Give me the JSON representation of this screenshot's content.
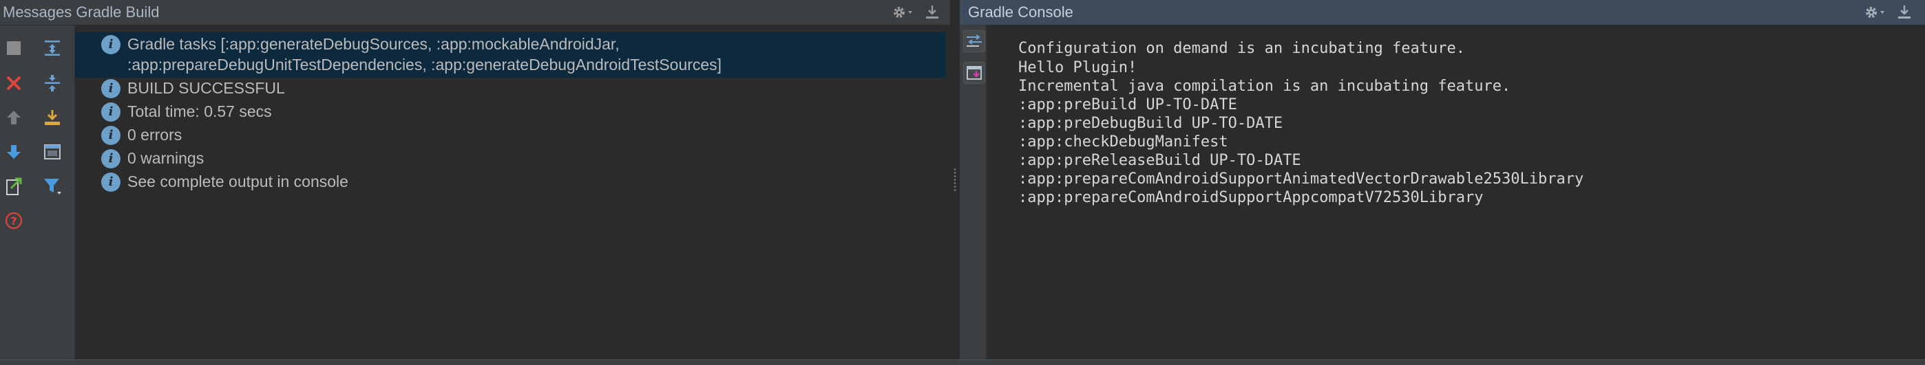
{
  "left_panel": {
    "title": "Messages Gradle Build",
    "header_tools": [
      {
        "icon": "gear-icon"
      },
      {
        "icon": "hide-panel-icon"
      }
    ],
    "toolbar": [
      {
        "icon": "stop-icon",
        "color": "#9a9a9a"
      },
      {
        "icon": "close-icon",
        "color": "#e0443b"
      },
      {
        "icon": "arrow-up-icon",
        "color": "#7a7f85"
      },
      {
        "icon": "arrow-down-icon",
        "color": "#4a9be0"
      },
      {
        "icon": "export-icon",
        "color": "#62b543"
      },
      {
        "icon": "help-icon",
        "color": "#e0443b"
      },
      {
        "icon": "expand-all-icon",
        "color": "#6aa3d8"
      },
      {
        "icon": "collapse-all-icon",
        "color": "#6aa3d8"
      },
      {
        "icon": "download-icon",
        "color": "#d9a741"
      },
      {
        "icon": "preview-icon",
        "color": "#6aa3d8"
      },
      {
        "icon": "filter-icon",
        "color": "#4a9be0"
      }
    ],
    "messages": [
      {
        "icon": "info-icon",
        "lines": [
          "Gradle tasks [:app:generateDebugSources, :app:mockableAndroidJar,",
          ":app:prepareDebugUnitTestDependencies, :app:generateDebugAndroidTestSources]"
        ],
        "selected": true
      },
      {
        "icon": "info-icon",
        "lines": [
          "BUILD SUCCESSFUL"
        ]
      },
      {
        "icon": "info-icon",
        "lines": [
          "Total time: 0.57 secs"
        ]
      },
      {
        "icon": "info-icon",
        "lines": [
          "0 errors"
        ]
      },
      {
        "icon": "info-icon",
        "lines": [
          "0 warnings"
        ]
      },
      {
        "icon": "info-icon",
        "lines": [
          "See complete output in console"
        ]
      }
    ]
  },
  "right_panel": {
    "title": "Gradle Console",
    "header_tools": [
      {
        "icon": "gear-icon"
      },
      {
        "icon": "hide-panel-icon"
      }
    ],
    "toolbar": [
      {
        "icon": "soft-wrap-icon"
      },
      {
        "icon": "scroll-to-end-icon"
      }
    ],
    "console_lines": [
      "Configuration on demand is an incubating feature.",
      "Hello Plugin!",
      "Incremental java compilation is an incubating feature.",
      ":app:preBuild UP-TO-DATE",
      ":app:preDebugBuild UP-TO-DATE",
      ":app:checkDebugManifest",
      ":app:preReleaseBuild UP-TO-DATE",
      ":app:prepareComAndroidSupportAnimatedVectorDrawable2530Library",
      ":app:prepareComAndroidSupportAppcompatV72530Library"
    ]
  },
  "colors": {
    "header_bg": "#3c3f41",
    "active_header_bg": "#3d4b5c",
    "content_bg": "#2b2b2b",
    "selection_bg": "#0d293e",
    "info_icon": "#6ea1c9",
    "text": "#bbbbbb"
  }
}
